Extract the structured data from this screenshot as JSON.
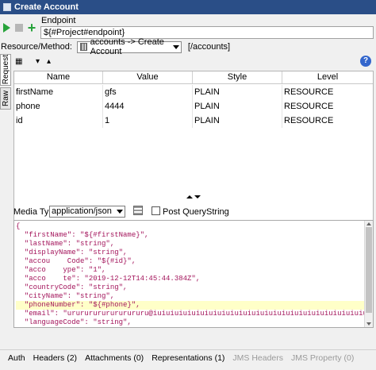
{
  "window": {
    "title": "Create Account"
  },
  "endpoint": {
    "label": "Endpoint",
    "value": "${#Project#endpoint}"
  },
  "resource": {
    "label": "Resource/Method:",
    "selected": "accounts -> Create Account",
    "path": "[/accounts]"
  },
  "side_tabs": {
    "request": "Request",
    "raw": "Raw"
  },
  "table": {
    "headers": [
      "Name",
      "Value",
      "Style",
      "Level"
    ],
    "rows": [
      [
        "firstName",
        "gfs",
        "PLAIN",
        "RESOURCE"
      ],
      [
        "phone",
        "4444",
        "PLAIN",
        "RESOURCE"
      ],
      [
        "id",
        "1",
        "PLAIN",
        "RESOURCE"
      ]
    ]
  },
  "media": {
    "label": "Media Type",
    "value": "application/json",
    "post_label": "Post QueryString"
  },
  "body_lines": [
    "{",
    "  \"firstName\": \"${#firstName}\",",
    "  \"lastName\": \"string\",",
    "  \"displayName\": \"string\",",
    "  \"accou    Code\": \"${#id}\",",
    "  \"acco    ype\": \"1\",",
    "  \"acco    te\": \"2019-12-12T14:45:44.384Z\",",
    "  \"countryCode\": \"string\",",
    "  \"cityName\": \"string\",",
    "  \"phoneNumber\": \"${#phone}\",",
    "  \"email\": \"urururururururururu@iuiuiuiuiuiuiuiuiuiuiuiuiuiuiuiuiuiuiuiuiuiuiuiuiuiuiu",
    "  \"languageCode\": \"string\","
  ],
  "bottom_tabs": [
    "Auth",
    "Headers (2)",
    "Attachments (0)",
    "Representations (1)",
    "JMS Headers",
    "JMS Property (0)"
  ]
}
